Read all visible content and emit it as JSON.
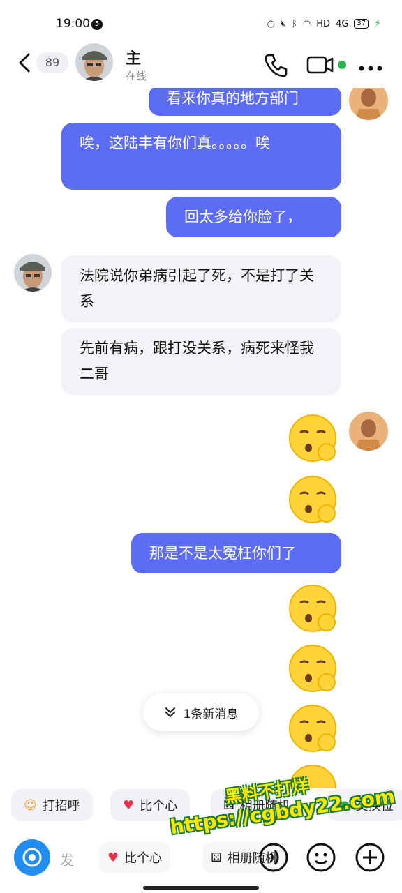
{
  "status_bar": {
    "time": "19:00",
    "notif_count": "5",
    "network": "4G",
    "hd": "HD",
    "battery": "37"
  },
  "header": {
    "unread_count": "89",
    "contact_name": "主",
    "contact_status": "在线"
  },
  "messages": [
    {
      "dir": "out",
      "text": "看来你真的地方部门"
    },
    {
      "dir": "out",
      "text": "唉，这陆丰有你们真。。。。。唉"
    },
    {
      "dir": "out",
      "text": "回太多给你脸了，"
    },
    {
      "dir": "in",
      "text": "法院说你弟病引起了死，不是打了关系"
    },
    {
      "dir": "in",
      "text": "先前有病，跟打没关系，病死来怪我二哥"
    },
    {
      "dir": "out",
      "emoji": "thinking-face-emoji"
    },
    {
      "dir": "out",
      "emoji": "thinking-face-emoji"
    },
    {
      "dir": "out",
      "text": "那是不是太冤枉你们了"
    },
    {
      "dir": "out",
      "emoji": "thinking-face-emoji"
    },
    {
      "dir": "out",
      "emoji": "thinking-face-emoji"
    },
    {
      "dir": "out",
      "emoji": "thinking-face-emoji"
    }
  ],
  "new_message_pill": "1条新消息",
  "quick_actions": [
    "打招呼",
    "比个心",
    "相册随机",
    "交换位"
  ],
  "input_bar": {
    "placeholder": "发",
    "suggestions": [
      "比个心",
      "相册随机"
    ]
  },
  "watermark": {
    "line1": "黑料不打烊",
    "line2": "https://cgbdy22.com"
  },
  "colors": {
    "outgoing_bubble": "#5c6cf5",
    "incoming_bubble": "#f2f3f6",
    "online": "#2bb64e",
    "accent": "#1f8ef0"
  }
}
